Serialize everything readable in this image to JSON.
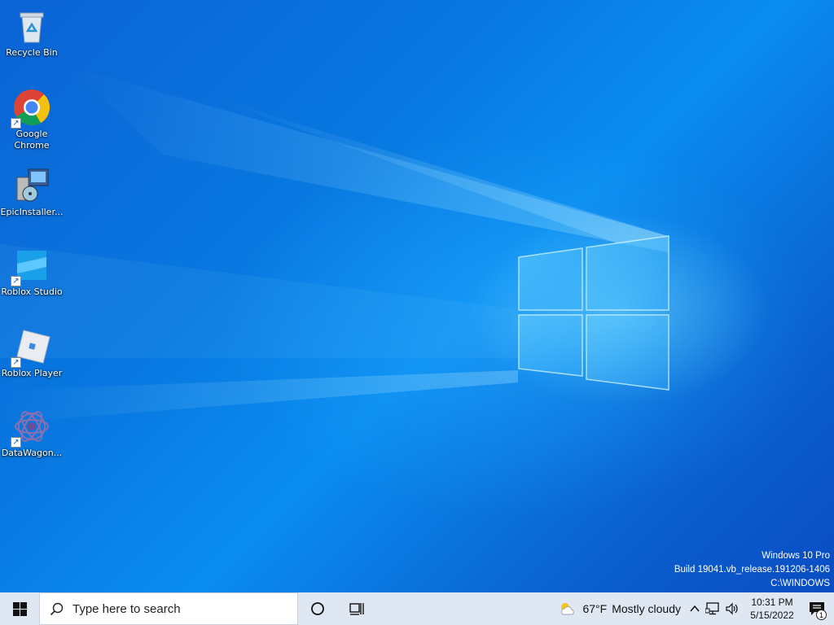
{
  "desktop": {
    "icons": [
      {
        "label": "Recycle Bin",
        "icon": "recycle-bin-icon"
      },
      {
        "label": "Google Chrome",
        "icon": "chrome-icon"
      },
      {
        "label": "EpicInstaller...",
        "icon": "installer-icon"
      },
      {
        "label": "Roblox Studio",
        "icon": "roblox-studio-icon"
      },
      {
        "label": "Roblox Player",
        "icon": "roblox-player-icon"
      },
      {
        "label": "DataWagon...",
        "icon": "datawagon-icon"
      }
    ],
    "watermark": {
      "line1": "Windows 10 Pro",
      "line2": "Build 19041.vb_release.191206-1406",
      "line3": "C:\\WINDOWS"
    }
  },
  "taskbar": {
    "search_placeholder": "Type here to search",
    "weather": {
      "temp": "67°F",
      "condition": "Mostly cloudy"
    },
    "clock": {
      "time": "10:31 PM",
      "date": "5/15/2022"
    },
    "notification_count": "1",
    "colors": {
      "taskbar_bg": "#dfe7f3",
      "desktop_accent": "#0a6fd8"
    }
  }
}
